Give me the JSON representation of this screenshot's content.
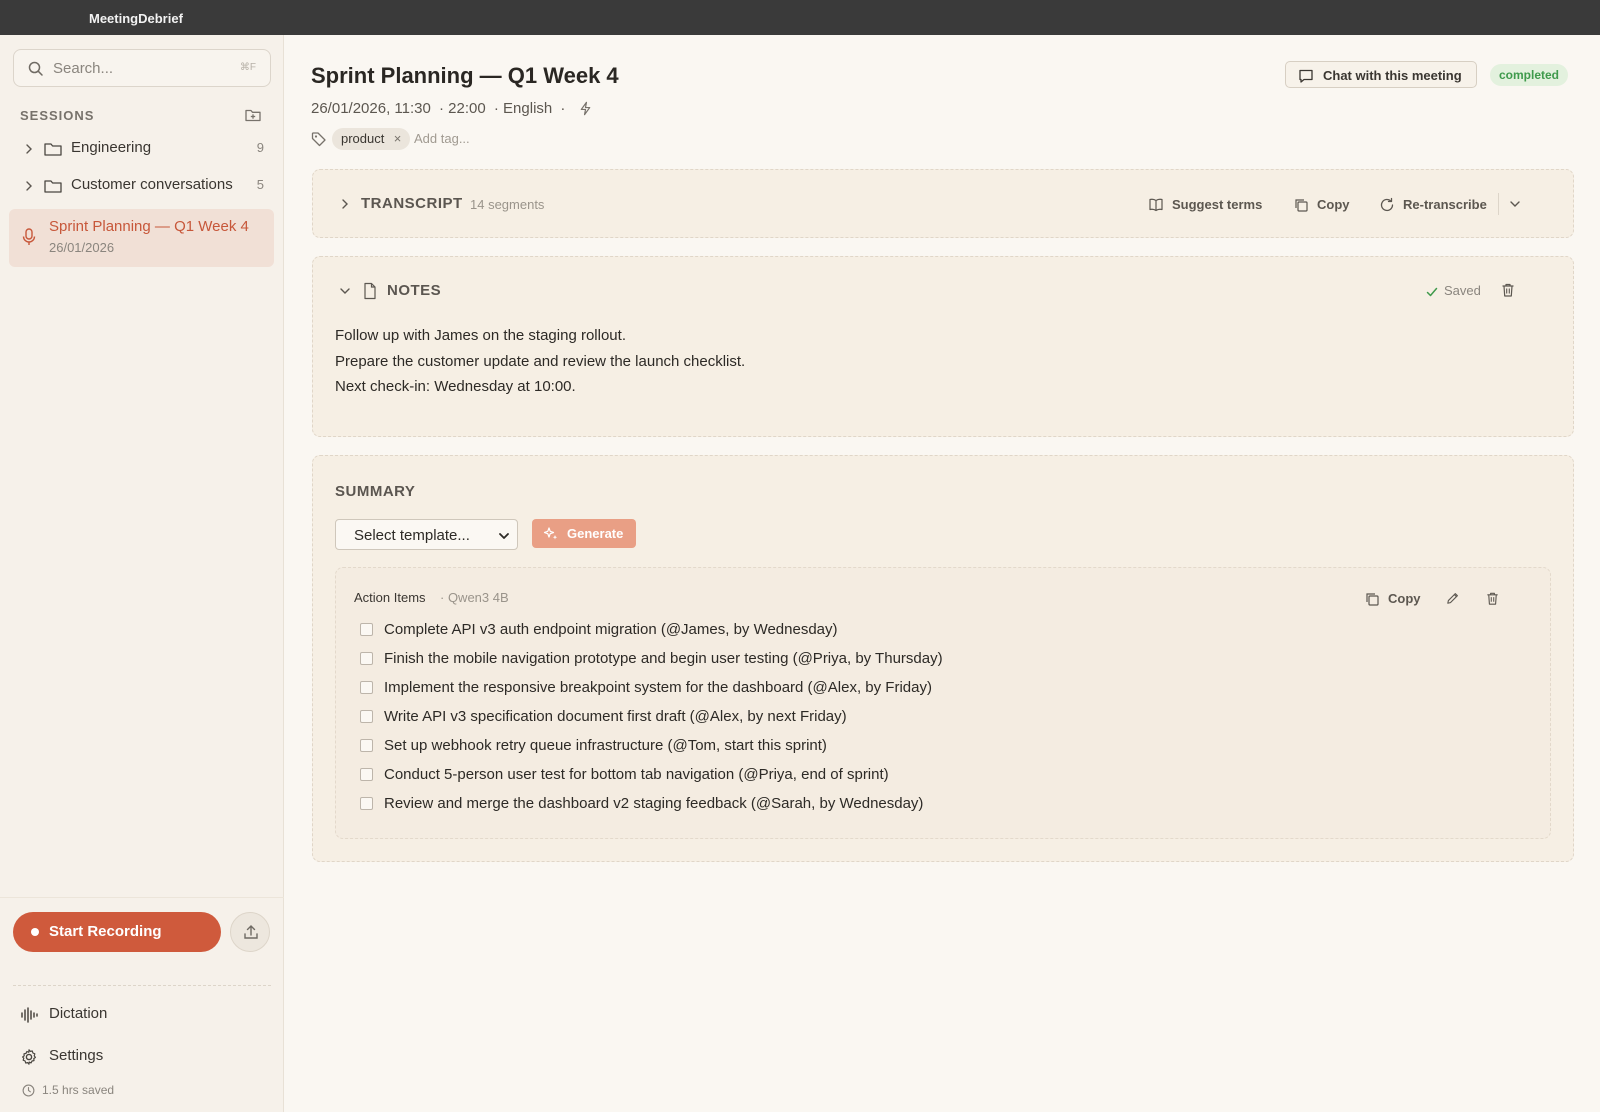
{
  "app": {
    "title": "MeetingDebrief"
  },
  "sidebar": {
    "search_placeholder": "Search...",
    "search_shortcut": "⌘F",
    "sessions_header": "SESSIONS",
    "folders": [
      {
        "name": "Engineering",
        "count": "9"
      },
      {
        "name": "Customer conversations",
        "count": "5"
      }
    ],
    "active_session": {
      "title": "Sprint Planning — Q1 Week 4",
      "date": "26/01/2026"
    },
    "record_label": "Start Recording",
    "nav": [
      {
        "label": "Dictation",
        "icon": "waveform-icon"
      },
      {
        "label": "Settings",
        "icon": "gear-icon"
      }
    ],
    "saved_stat": "1.5 hrs saved"
  },
  "meeting": {
    "title": "Sprint Planning — Q1 Week 4",
    "date_time": "26/01/2026, 11:30",
    "duration": "· 22:00",
    "language": "· English",
    "separator": "·",
    "chat_label": "Chat with this meeting",
    "status": "completed",
    "tags": [
      "product"
    ],
    "add_tag_placeholder": "Add tag..."
  },
  "transcript": {
    "title": "TRANSCRIPT",
    "segments": "14 segments",
    "suggest_label": "Suggest terms",
    "copy_label": "Copy",
    "retranscribe_label": "Re-transcribe"
  },
  "notes": {
    "title": "NOTES",
    "saved_label": "Saved",
    "lines": [
      "Follow up with James on the staging rollout.",
      "Prepare the customer update and review the launch checklist.",
      "Next check-in: Wednesday at 10:00."
    ]
  },
  "summary": {
    "title": "SUMMARY",
    "template_placeholder": "Select template...",
    "generate_label": "Generate",
    "card": {
      "title": "Action Items",
      "model": "· Qwen3 4B",
      "copy_label": "Copy",
      "items": [
        "Complete API v3 auth endpoint migration (@James, by Wednesday)",
        "Finish the mobile navigation prototype and begin user testing (@Priya, by Thursday)",
        "Implement the responsive breakpoint system for the dashboard (@Alex, by Friday)",
        "Write API v3 specification document first draft (@Alex, by next Friday)",
        "Set up webhook retry queue infrastructure (@Tom, start this sprint)",
        "Conduct 5-person user test for bottom tab navigation (@Priya, end of sprint)",
        "Review and merge the dashboard v2 staging feedback (@Sarah, by Wednesday)"
      ]
    }
  },
  "colors": {
    "accent": "#cf5a3c",
    "status_green": "#3f9a4c",
    "titlebar": "#3a3a3a"
  }
}
